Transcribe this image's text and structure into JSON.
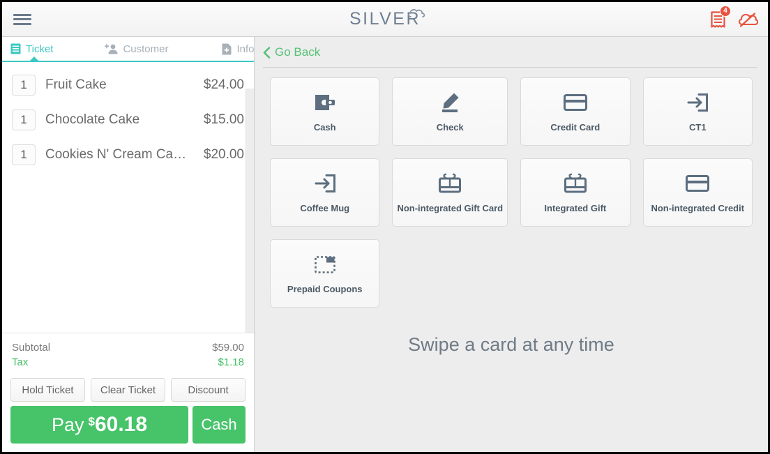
{
  "app": {
    "logo_text": "SILVER",
    "logo_icon": "cloud-icon",
    "menu_icon": "hamburger-menu-icon",
    "receipt_icon": "receipt-icon",
    "receipt_badge": "4",
    "cloud_offline_icon": "cloud-offline-icon",
    "accent_teal": "#3fc8c3",
    "accent_green": "#47c36a",
    "accent_orange": "#e8523f",
    "icon_slate": "#5c6e7f"
  },
  "left_panel": {
    "tabs": [
      {
        "label": "Ticket",
        "icon": "receipt-icon",
        "active": true
      },
      {
        "label": "Customer",
        "icon": "add-person-icon",
        "active": false
      },
      {
        "label": "Info",
        "icon": "document-add-icon",
        "active": false
      }
    ],
    "items": [
      {
        "qty": "1",
        "name": "Fruit Cake",
        "price": "$24.00"
      },
      {
        "qty": "1",
        "name": "Chocolate Cake",
        "price": "$15.00"
      },
      {
        "qty": "1",
        "name": "Cookies N' Cream Ca…",
        "price": "$20.00"
      }
    ],
    "totals": [
      {
        "label": "Subtotal",
        "value": "$59.00",
        "highlight": false
      },
      {
        "label": "Tax",
        "value": "$1.18",
        "highlight": true
      }
    ],
    "actions": [
      {
        "label": "Hold Ticket"
      },
      {
        "label": "Clear Ticket"
      },
      {
        "label": "Discount"
      }
    ],
    "pay": {
      "label": "Pay",
      "currency": "$",
      "amount": "60.18",
      "cash_label": "Cash"
    }
  },
  "right_panel": {
    "go_back_label": "Go Back",
    "go_back_icon": "chevron-left-icon",
    "swipe_message": "Swipe a card at any time",
    "tiles": [
      {
        "label": "Cash",
        "icon": "wallet-icon"
      },
      {
        "label": "Check",
        "icon": "pencil-signature-icon"
      },
      {
        "label": "Credit Card",
        "icon": "credit-card-icon"
      },
      {
        "label": "CT1",
        "icon": "arrow-into-box-icon"
      },
      {
        "label": "Coffee Mug",
        "icon": "arrow-into-box-icon"
      },
      {
        "label": "Non-integrated Gift Card",
        "icon": "gift-card-icon"
      },
      {
        "label": "Integrated Gift",
        "icon": "gift-card-icon"
      },
      {
        "label": "Non-integrated Credit",
        "icon": "credit-card-icon"
      },
      {
        "label": "Prepaid Coupons",
        "icon": "coupon-dashed-icon"
      }
    ]
  }
}
